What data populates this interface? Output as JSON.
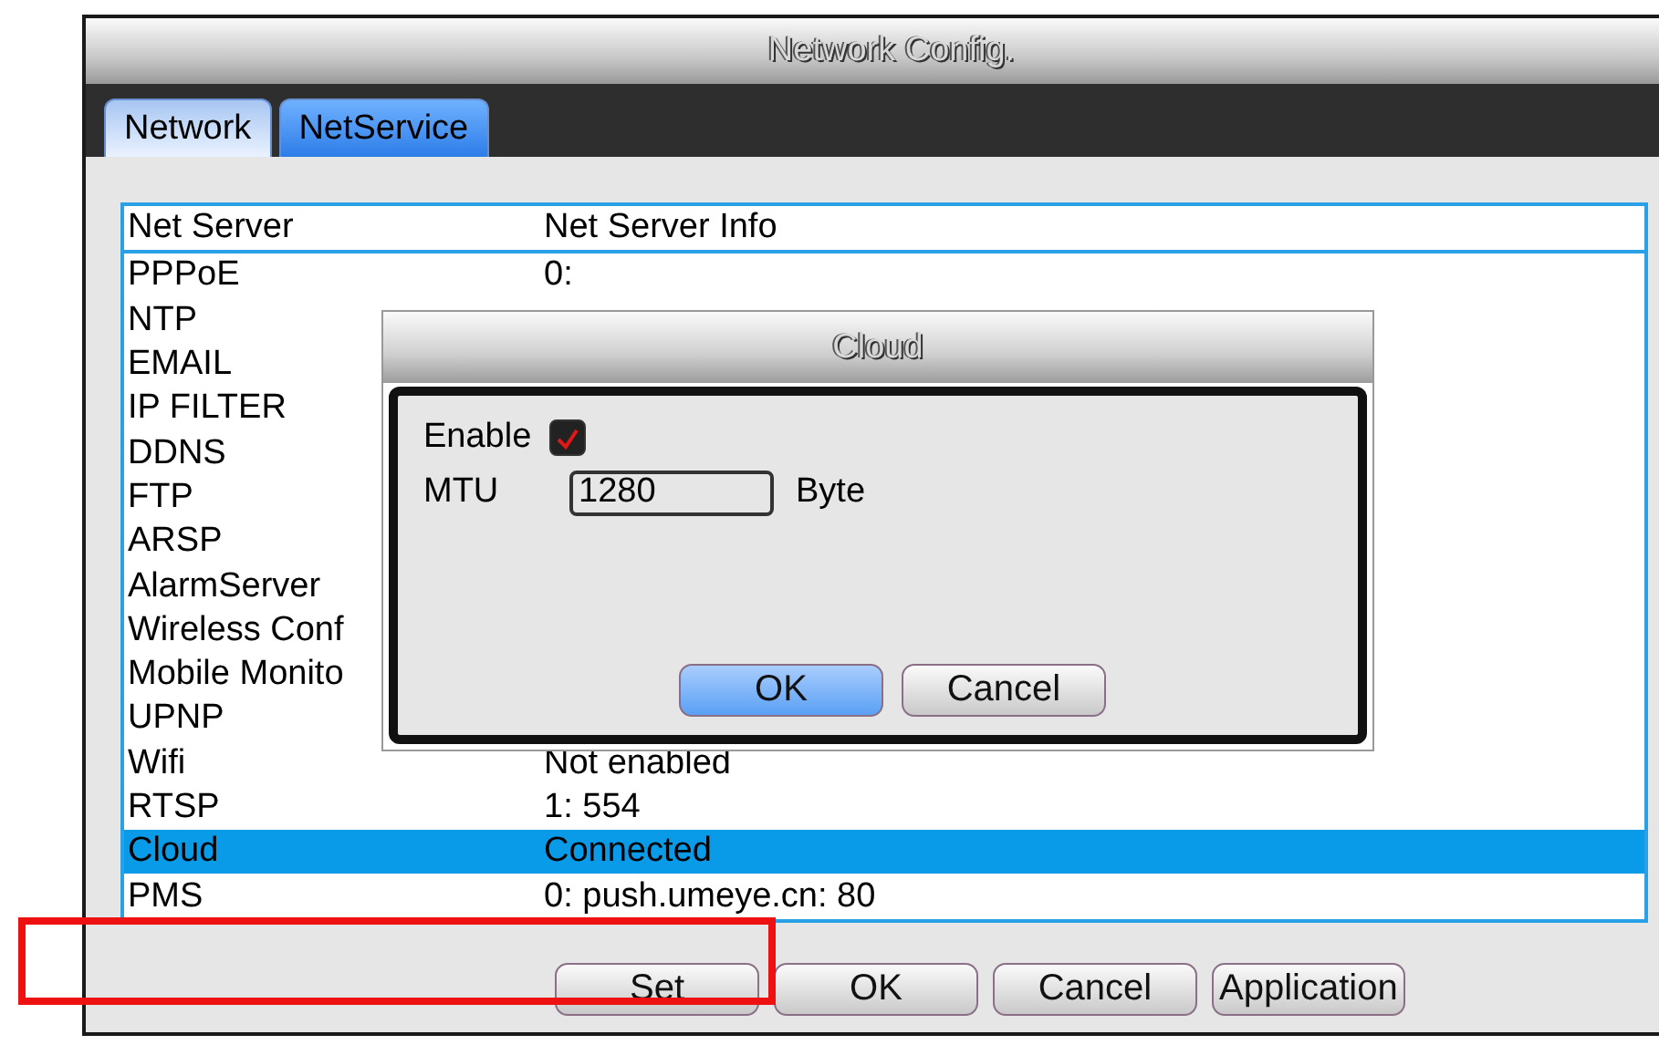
{
  "window": {
    "title": "Network Config."
  },
  "tabs": [
    {
      "label": "Network",
      "selected": false
    },
    {
      "label": "NetService",
      "selected": true
    }
  ],
  "table": {
    "columns": [
      "Net Server",
      "Net Server Info"
    ],
    "rows": [
      {
        "name": "PPPoE",
        "info": "0:",
        "selected": false
      },
      {
        "name": "NTP",
        "selected": false
      },
      {
        "name": "EMAIL",
        "selected": false
      },
      {
        "name": "IP FILTER",
        "selected": false
      },
      {
        "name": "DDNS",
        "selected": false
      },
      {
        "name": "FTP",
        "selected": false
      },
      {
        "name": "ARSP",
        "selected": false
      },
      {
        "name": "AlarmServer",
        "selected": false
      },
      {
        "name": "Wireless Conf",
        "selected": false
      },
      {
        "name": "Mobile Monito",
        "selected": false
      },
      {
        "name": "UPNP",
        "selected": false
      },
      {
        "name": "Wifi",
        "info": "Not enabled",
        "selected": false
      },
      {
        "name": "RTSP",
        "info": "1: 554",
        "selected": false
      },
      {
        "name": "Cloud",
        "info": "Connected",
        "selected": true
      },
      {
        "name": "PMS",
        "info": "0: push.umeye.cn: 80",
        "selected": false
      }
    ]
  },
  "buttons": [
    "Set",
    "OK",
    "Cancel",
    "Application"
  ],
  "dialog": {
    "title": "Cloud",
    "enable": {
      "label": "Enable",
      "checked": true
    },
    "mtu": {
      "label": "MTU",
      "value": "1280",
      "unit": "Byte"
    },
    "buttons": [
      {
        "label": "OK",
        "focused": true
      },
      {
        "label": "Cancel",
        "focused": false
      }
    ]
  }
}
